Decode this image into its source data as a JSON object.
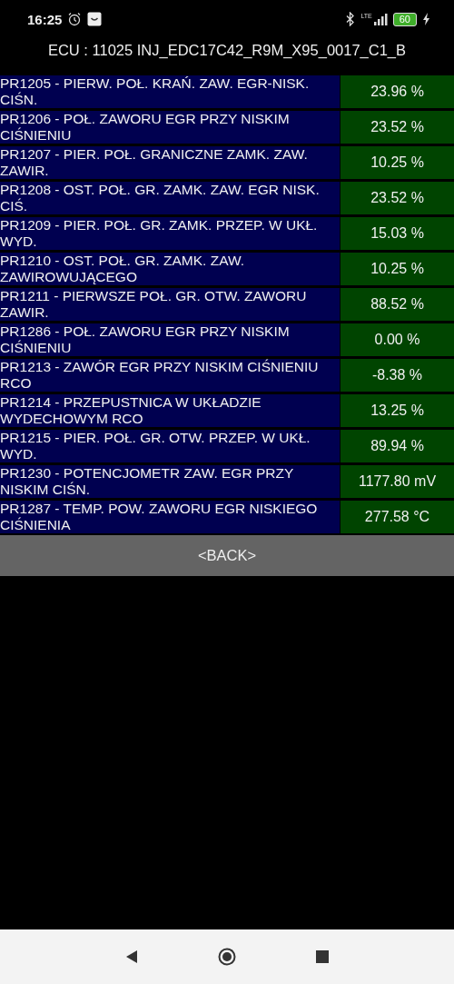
{
  "status_bar": {
    "time": "16:25",
    "network": "LTE",
    "battery": "60"
  },
  "header": {
    "title": "ECU : 11025  INJ_EDC17C42_R9M_X95_0017_C1_B"
  },
  "rows": [
    {
      "label": "PR1205 - PIERW. POŁ. KRAŃ. ZAW. EGR-NISK. CIŚN.",
      "value": "23.96 %"
    },
    {
      "label": "PR1206 - POŁ. ZAWORU EGR PRZY NISKIM CIŚNIENIU",
      "value": "23.52 %"
    },
    {
      "label": "PR1207 - PIER. POŁ. GRANICZNE ZAMK. ZAW. ZAWIR.",
      "value": "10.25 %"
    },
    {
      "label": "PR1208 - OST. POŁ. GR. ZAMK. ZAW. EGR NISK. CIŚ.",
      "value": "23.52 %"
    },
    {
      "label": "PR1209 - PIER. POŁ. GR. ZAMK. PRZEP. W UKŁ. WYD.",
      "value": "15.03 %"
    },
    {
      "label": "PR1210 - OST. POŁ. GR. ZAMK. ZAW. ZAWIROWUJĄCEGO",
      "value": "10.25 %"
    },
    {
      "label": "PR1211 - PIERWSZE POŁ. GR. OTW. ZAWORU ZAWIR.",
      "value": "88.52 %"
    },
    {
      "label": "PR1286 - POŁ. ZAWORU EGR PRZY NISKIM CIŚNIENIU",
      "value": "0.00 %"
    },
    {
      "label": "PR1213 - ZAWÓR EGR PRZY NISKIM CIŚNIENIU RCO",
      "value": "-8.38 %"
    },
    {
      "label": "PR1214 - PRZEPUSTNICA W UKŁADZIE WYDECHOWYM RCO",
      "value": "13.25 %"
    },
    {
      "label": "PR1215 - PIER. POŁ. GR. OTW. PRZEP. W UKŁ. WYD.",
      "value": "89.94 %"
    },
    {
      "label": "PR1230 - POTENCJOMETR ZAW. EGR PRZY NISKIM CIŚN.",
      "value": "1177.80 mV"
    },
    {
      "label": "PR1287 - TEMP. POW. ZAWORU EGR NISKIEGO CIŚNIENIA",
      "value": "277.58 °C"
    }
  ],
  "back_button": {
    "label": "<BACK>"
  }
}
